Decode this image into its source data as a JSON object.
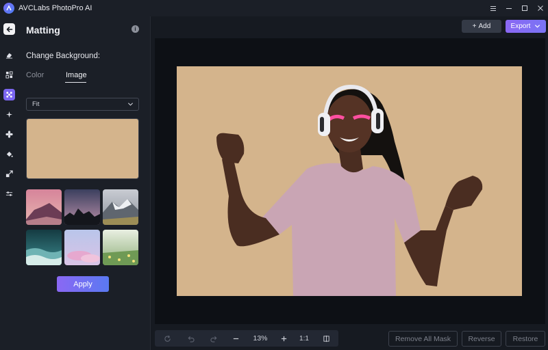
{
  "app": {
    "title": "AVCLabs PhotoPro AI",
    "icons": {
      "logo": "avclabs-logo-icon",
      "menu": "hamburger-icon",
      "minimize": "minimize-icon",
      "maximize": "maximize-icon",
      "close": "close-icon"
    }
  },
  "rail": {
    "back": "back-arrow-icon",
    "items": [
      {
        "icon": "eraser-icon"
      },
      {
        "icon": "enhance-icon"
      },
      {
        "icon": "matting-icon",
        "active": true
      },
      {
        "icon": "sparkle-icon"
      },
      {
        "icon": "fan-icon"
      },
      {
        "icon": "paint-bucket-icon"
      },
      {
        "icon": "resize-icon"
      },
      {
        "icon": "adjust-sliders-icon"
      }
    ]
  },
  "panel": {
    "title": "Matting",
    "section_label": "Change Background:",
    "tabs": [
      {
        "label": "Color",
        "active": false
      },
      {
        "label": "Image",
        "active": true
      }
    ],
    "fit_select": {
      "value": "Fit"
    },
    "background_color": "#d4b48c",
    "thumbnails": [
      {
        "icon": "mountain-sunset-thumb"
      },
      {
        "icon": "dusk-trees-thumb"
      },
      {
        "icon": "snowy-mountains-thumb"
      },
      {
        "icon": "ocean-waves-thumb"
      },
      {
        "icon": "pink-clouds-thumb"
      },
      {
        "icon": "flower-field-thumb"
      }
    ],
    "apply_label": "Apply"
  },
  "toolbar": {
    "add_label": "Add",
    "export_label": "Export"
  },
  "bottom": {
    "zoom_value": "13%",
    "ratio_label": "1:1",
    "remove_all_mask_label": "Remove All Mask",
    "reverse_label": "Reverse",
    "restore_label": "Restore"
  },
  "colors": {
    "accent": "#7b66f0",
    "panel_bg": "#1b1f27",
    "canvas_bg": "#0d1015"
  }
}
